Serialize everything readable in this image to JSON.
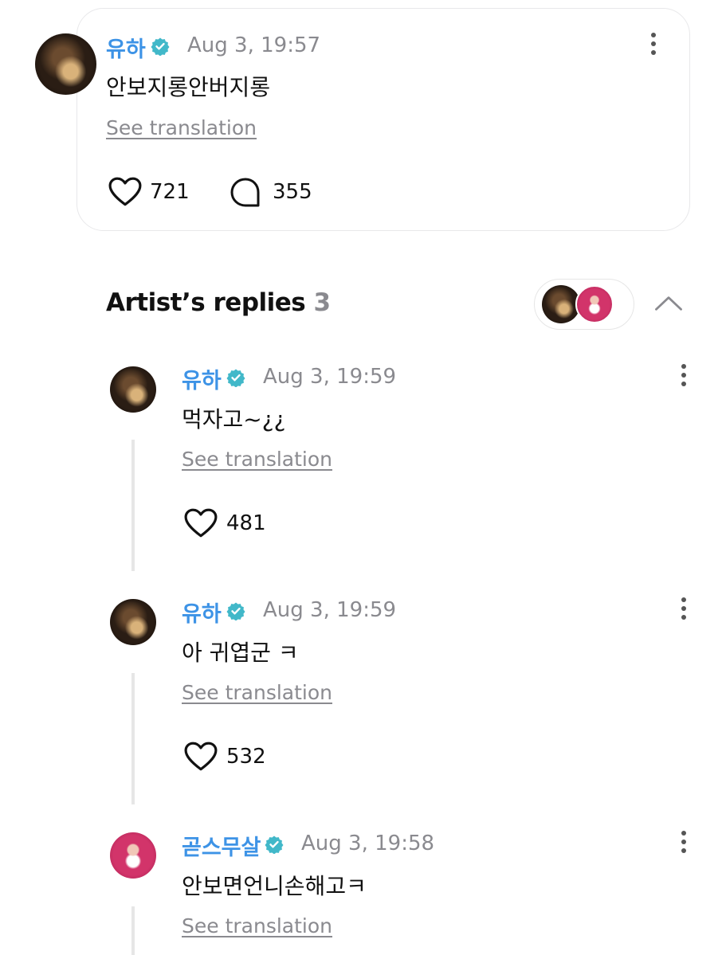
{
  "post": {
    "author": "유하",
    "time": "Aug 3, 19:57",
    "text": "안보지롱안버지롱",
    "see_translation": "See translation",
    "likes": "721",
    "comments": "355"
  },
  "artist_replies": {
    "title": "Artist’s replies",
    "count": "3"
  },
  "replies": [
    {
      "author": "유하",
      "time": "Aug 3, 19:59",
      "text": "먹자고~¿¿",
      "see_translation": "See translation",
      "likes": "481"
    },
    {
      "author": "유하",
      "time": "Aug 3, 19:59",
      "text": "아 귀엽군 ㅋ",
      "see_translation": "See translation",
      "likes": "532"
    },
    {
      "author": "곧스무살",
      "time": "Aug 3, 19:58",
      "text": "안보면언니손해고ㅋ",
      "see_translation": "See translation"
    }
  ],
  "colors": {
    "name_blue": "#3d93e6",
    "verified_teal": "#41b8c9",
    "muted": "#8a8a8f"
  },
  "icons": [
    "verified-badge-icon",
    "heart-icon",
    "comment-bubble-icon",
    "more-vertical-icon",
    "chevron-up-icon"
  ]
}
